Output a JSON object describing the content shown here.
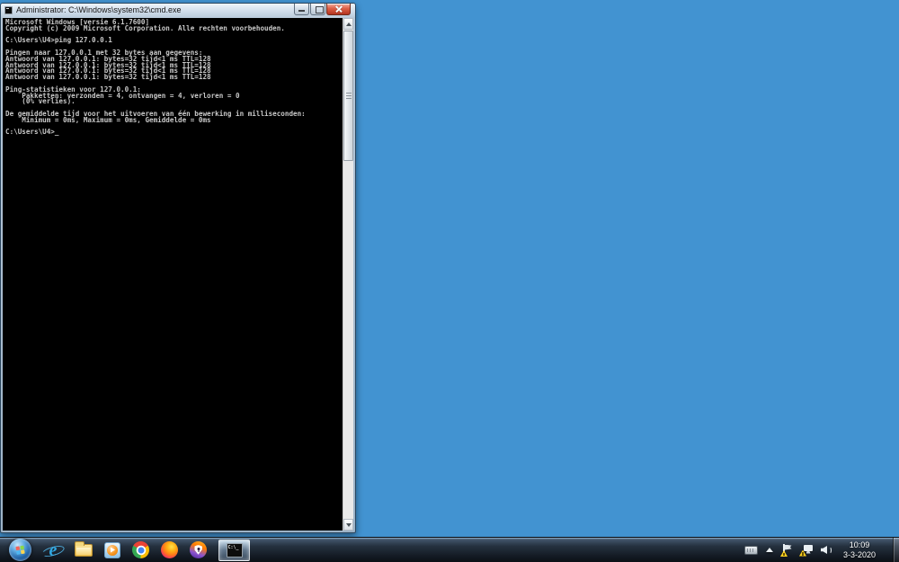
{
  "window": {
    "title": "Administrator: C:\\Windows\\system32\\cmd.exe",
    "console_lines": [
      "Microsoft Windows [versie 6.1.7600]",
      "Copyright (c) 2009 Microsoft Corporation. Alle rechten voorbehouden.",
      "",
      "C:\\Users\\U4>ping 127.0.0.1",
      "",
      "Pingen naar 127.0.0.1 met 32 bytes aan gegevens:",
      "Antwoord van 127.0.0.1: bytes=32 tijd<1 ms TTL=128",
      "Antwoord van 127.0.0.1: bytes=32 tijd<1 ms TTL=128",
      "Antwoord van 127.0.0.1: bytes=32 tijd<1 ms TTL=128",
      "Antwoord van 127.0.0.1: bytes=32 tijd<1 ms TTL=128",
      "",
      "Ping-statistieken voor 127.0.0.1:",
      "    Pakketten: verzonden = 4, ontvangen = 4, verloren = 0",
      "    (0% verlies).",
      "",
      "De gemiddelde tijd voor het uitvoeren van één bewerking in milliseconden:",
      "    Minimum = 0ms, Maximum = 0ms, Gemiddelde = 0ms",
      "",
      "C:\\Users\\U4>_"
    ]
  },
  "taskbar": {
    "ie_glyph": "e",
    "cmd_icon_text": "C:\\_",
    "items": [
      "start-button",
      "internet-explorer",
      "windows-explorer",
      "windows-media-player",
      "google-chrome",
      "firefox",
      "privacy-shield-browser",
      "command-prompt-active"
    ]
  },
  "tray": {
    "icons": [
      "keyboard",
      "show-hidden-icons",
      "action-center-flag-warning",
      "network-warning",
      "volume"
    ],
    "time": "10:09",
    "date": "3-3-2020"
  },
  "colors": {
    "desktop_bg": "#4293d1",
    "console_bg": "#000000",
    "console_text": "#c8c8c8",
    "close_button_red": "#c24534",
    "warning_yellow": "#ffd21e"
  }
}
